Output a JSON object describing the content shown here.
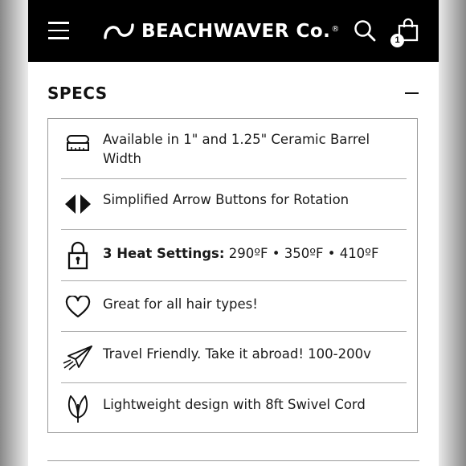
{
  "header": {
    "brand": "BEACHWAVER Co.",
    "registered": "®",
    "cart_count": "1",
    "icons": {
      "menu": "hamburger-menu-icon",
      "logo": "wave-logo-icon",
      "search": "search-icon",
      "cart": "shopping-bag-icon"
    }
  },
  "specs": {
    "title": "SPECS",
    "toggle_icon": "minus-collapse-icon",
    "items": [
      {
        "icon": "barrel-icon",
        "text": "Available in 1\" and 1.25\" Ceramic Barrel Width"
      },
      {
        "icon": "arrow-buttons-icon",
        "text": "Simplified Arrow Buttons for Rotation"
      },
      {
        "icon": "lock-icon",
        "bold": "3 Heat Settings:",
        "text": " 290ºF • 350ºF • 410ºF"
      },
      {
        "icon": "heart-icon",
        "text": "Great for all hair types!"
      },
      {
        "icon": "paper-plane-icon",
        "text": "Travel Friendly. Take it abroad! 100-200v"
      },
      {
        "icon": "leaf-icon",
        "text": "Lightweight design with 8ft Swivel Cord"
      }
    ]
  }
}
